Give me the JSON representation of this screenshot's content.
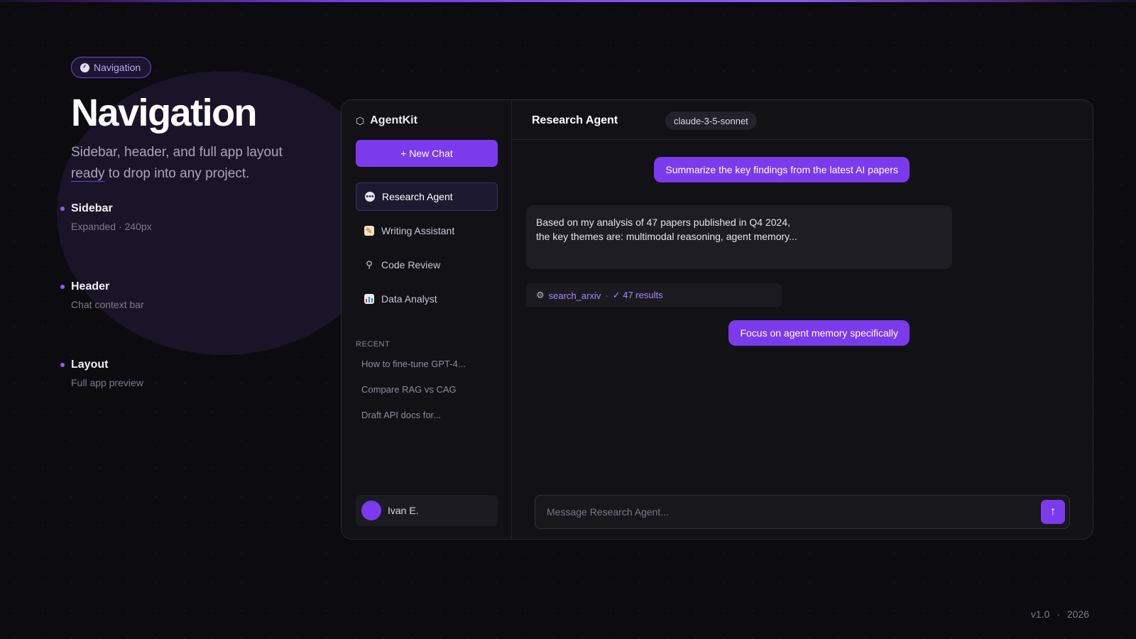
{
  "badge": {
    "icon": "compass-icon",
    "label": "Navigation"
  },
  "hero": {
    "title": "Navigation",
    "subtitle_part1": "Sidebar, header, and full app layout ",
    "subtitle_underlined": "ready",
    "subtitle_part2": " to drop into any project."
  },
  "features": [
    {
      "title": "Sidebar",
      "subtitle": "Expanded · 240px"
    },
    {
      "title": "Header",
      "subtitle": "Chat context bar"
    },
    {
      "title": "Layout",
      "subtitle": "Full app preview"
    }
  ],
  "app": {
    "brand": "AgentKit",
    "brand_icon": "hexagon-icon",
    "new_chat_label": "+ New Chat",
    "nav_items": [
      {
        "label": "Research Agent",
        "icon": "speech-bubble-icon",
        "active": true
      },
      {
        "label": "Writing Assistant",
        "icon": "memo-icon",
        "active": false
      },
      {
        "label": "Code Review",
        "icon": "magnifier-icon",
        "active": false
      },
      {
        "label": "Data Analyst",
        "icon": "bar-chart-icon",
        "active": false
      }
    ],
    "recent_heading": "RECENT",
    "recent_items": [
      "How to fine-tune GPT-4...",
      "Compare RAG vs CAG",
      "Draft API docs for..."
    ],
    "user_name": "Ivan E.",
    "header_title": "Research Agent",
    "model": "claude-3-5-sonnet",
    "messages": {
      "user1": "Summarize the key findings from the latest AI papers",
      "assistant_line1": "Based on my analysis of 47 papers published in Q4 2024,",
      "assistant_line2": "the key themes are: multimodal reasoning, agent memory...",
      "tool_name": "search_arxiv",
      "tool_result": "✓ 47 results",
      "user2": "Focus on agent memory specifically"
    },
    "composer_placeholder": "Message Research Agent...",
    "send_icon": "arrow-up-icon"
  },
  "footer": {
    "version": "v1.0",
    "separator": "·",
    "year": "2026"
  },
  "colors": {
    "accent": "#7c3aed",
    "background": "#0c0b10",
    "panel": "#121116"
  }
}
